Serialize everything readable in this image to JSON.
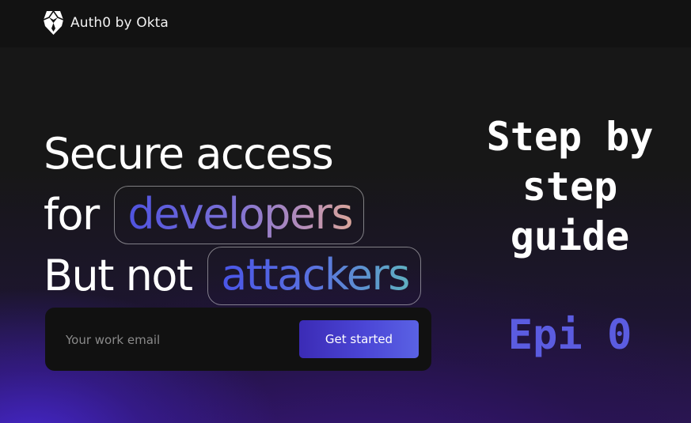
{
  "brand": {
    "name": "Auth0 by Okta",
    "logo_icon": "auth0-shield-icon"
  },
  "hero": {
    "line1": "Secure access",
    "line2_prefix": "for",
    "line2_highlight": "developers",
    "line3_prefix": "But not",
    "line3_highlight": "attackers"
  },
  "signup": {
    "email_placeholder": "Your work email",
    "email_value": "",
    "button_label": "Get started"
  },
  "overlay": {
    "guide_lines": [
      "Step by",
      "step",
      "guide"
    ],
    "episode": "Epi 0"
  },
  "colors": {
    "background": "#141414",
    "accent": "#4b46d6",
    "episode_text": "#5b5ce0"
  }
}
